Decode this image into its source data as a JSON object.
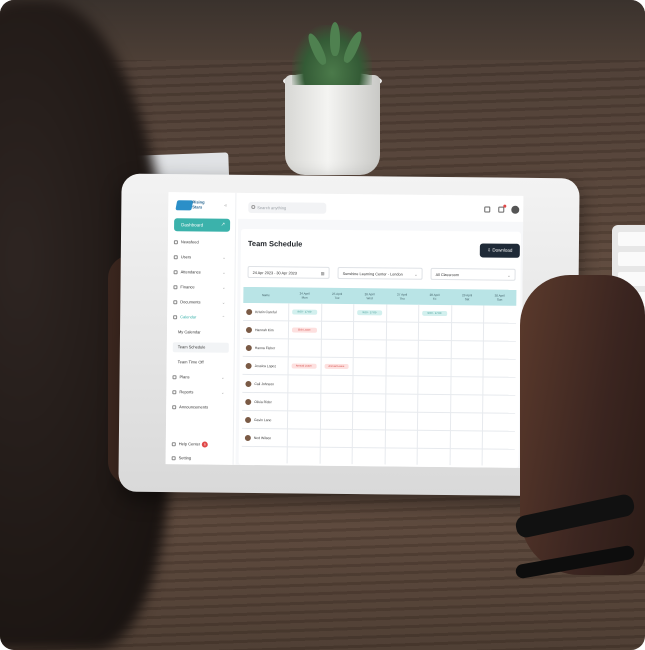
{
  "scene": {
    "description_colors": {
      "accent": "#3bb2ab",
      "dark_button": "#1f2a37",
      "header_teal": "#b9e4e6",
      "leave_red": "#d44a46"
    }
  },
  "app": {
    "logo_text": "Rising Stars",
    "search_placeholder": "Search anything",
    "sidebar": {
      "dashboard": "Dashboard",
      "items": [
        {
          "label": "Newsfeed",
          "icon": "newsfeed-icon"
        },
        {
          "label": "Users",
          "icon": "users-icon"
        },
        {
          "label": "Attendance",
          "icon": "attendance-icon"
        },
        {
          "label": "Finance",
          "icon": "finance-icon"
        },
        {
          "label": "Documents",
          "icon": "documents-icon"
        },
        {
          "label": "Calendar",
          "icon": "calendar-icon"
        },
        {
          "label": "My Calendar"
        },
        {
          "label": "Team Schedule"
        },
        {
          "label": "Team Time Off"
        },
        {
          "label": "Plans",
          "icon": "plans-icon"
        },
        {
          "label": "Reports",
          "icon": "reports-icon"
        },
        {
          "label": "Announcements",
          "icon": "announcements-icon"
        }
      ],
      "help_center": "Help Center",
      "help_badge": "8",
      "setting": "Setting"
    },
    "page": {
      "title": "Team Schedule",
      "download_label": "Download",
      "date_range": "24 Apr 2023 - 30 Apr 2023",
      "center_select": "Sunshine Learning Center - London",
      "classroom_select": "All Classroom"
    },
    "schedule": {
      "name_header": "Name",
      "days": [
        {
          "date": "24 April",
          "day": "Mon"
        },
        {
          "date": "25 April",
          "day": "Tue"
        },
        {
          "date": "26 April",
          "day": "Wed"
        },
        {
          "date": "27 April",
          "day": "Thu"
        },
        {
          "date": "28 April",
          "day": "Fri"
        },
        {
          "date": "29 April",
          "day": "Sat"
        },
        {
          "date": "30 April",
          "day": "Sun"
        }
      ],
      "rows": [
        {
          "name": "Kristin Careful"
        },
        {
          "name": "Hannah Kim"
        },
        {
          "name": "Hanna Fisher"
        },
        {
          "name": "Jessica Lopez"
        },
        {
          "name": "Cali Johnson"
        },
        {
          "name": "Olivia Rider"
        },
        {
          "name": "Gavin Lane"
        },
        {
          "name": "Ned Wilson"
        }
      ],
      "pills": [
        {
          "row": 0,
          "day": 0,
          "text": "9:00 - 17:00",
          "kind": "teal"
        },
        {
          "row": 0,
          "day": 2,
          "text": "9:00 - 17:00",
          "kind": "teal"
        },
        {
          "row": 0,
          "day": 4,
          "text": "9:00 - 17:00",
          "kind": "teal"
        },
        {
          "row": 1,
          "day": 0,
          "text": "Sick Leave",
          "kind": "red"
        },
        {
          "row": 3,
          "day": 0,
          "text": "Annual Leave",
          "kind": "red"
        },
        {
          "row": 3,
          "day": 1,
          "text": "Annual Leave",
          "kind": "red"
        }
      ]
    }
  }
}
